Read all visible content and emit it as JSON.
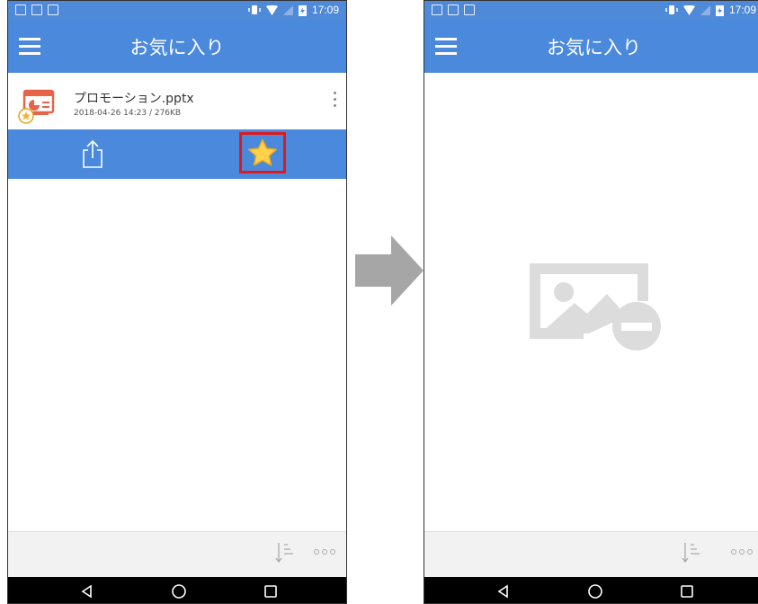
{
  "status_time": "17:09",
  "left_screen": {
    "title": "お気に入り",
    "file": {
      "name": "プロモーション.pptx",
      "meta": "2018-04-26 14:23 / 276KB"
    }
  },
  "right_screen": {
    "title": "お気に入り"
  },
  "colors": {
    "accent": "#4a89dc",
    "highlight": "#e0191c"
  }
}
